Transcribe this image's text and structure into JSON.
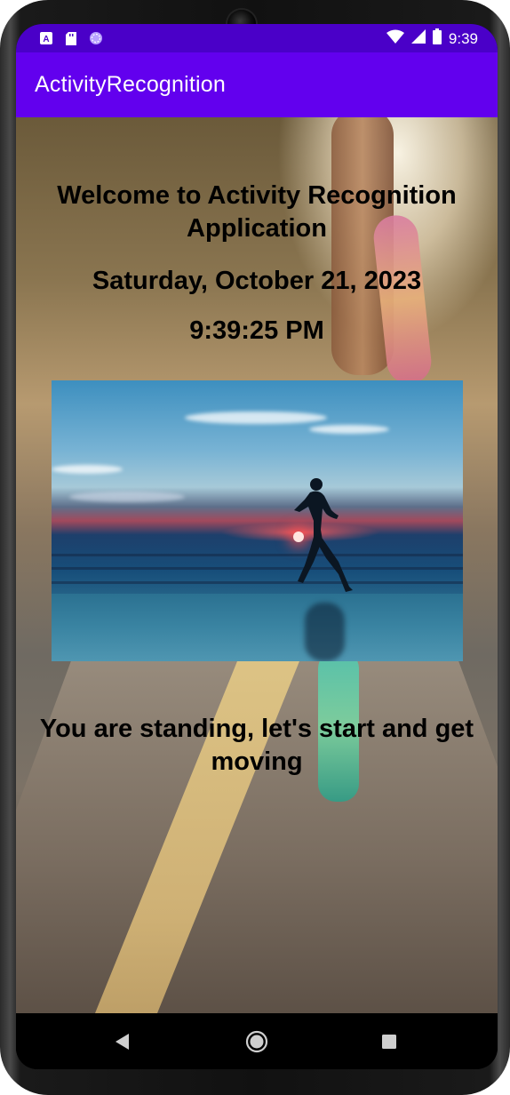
{
  "status_bar": {
    "time": "9:39",
    "left_icons": [
      "accessibility-icon",
      "sd-card-icon",
      "loading-circle-icon"
    ],
    "right_icons": [
      "wifi-icon",
      "signal-icon",
      "battery-icon"
    ]
  },
  "app_bar": {
    "title": "ActivityRecognition",
    "color": "#6200ee",
    "status_color": "#4a00c8"
  },
  "main": {
    "welcome_text": "Welcome to Activity Recognition Application",
    "date": "Saturday, October 21, 2023",
    "time": "9:39:25 PM",
    "activity_message": "You are standing, let's start and get moving",
    "image": "runner-on-beach-at-sunset"
  },
  "nav_bar": {
    "buttons": [
      "back-icon",
      "home-icon",
      "recents-icon"
    ]
  }
}
